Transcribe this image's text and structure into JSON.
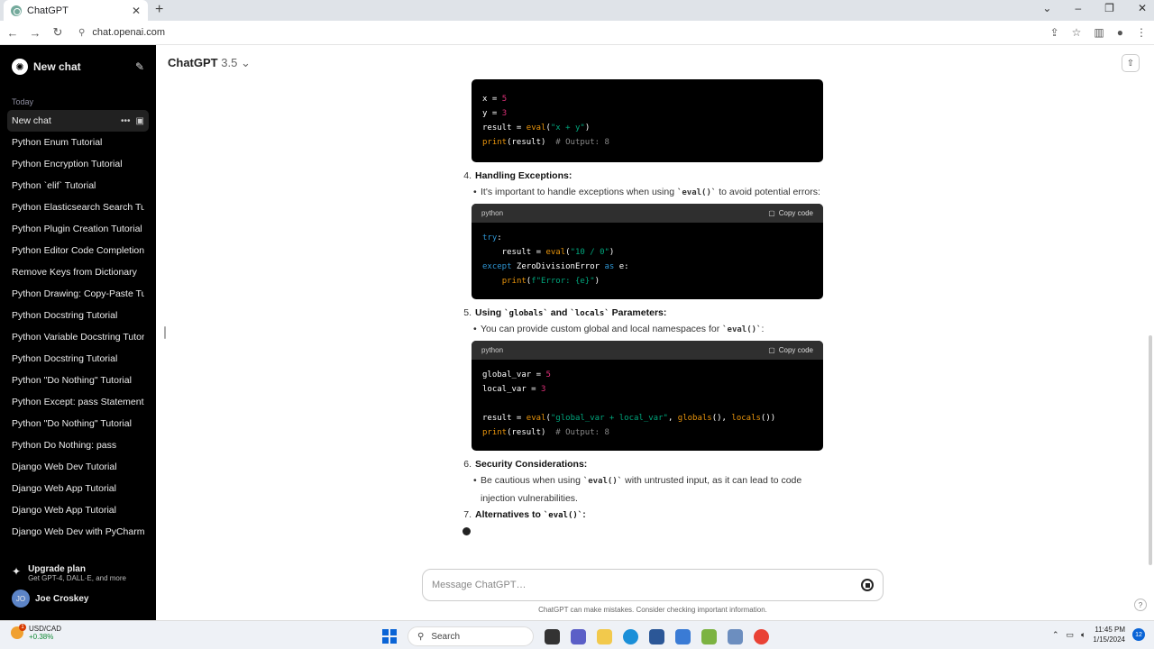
{
  "browser": {
    "tab_title": "ChatGPT",
    "url": "chat.openai.com"
  },
  "sidebar": {
    "new_chat": "New chat",
    "section": "Today",
    "active_item": "New chat",
    "items": [
      "Python Enum Tutorial",
      "Python Encryption Tutorial",
      "Python `elif` Tutorial",
      "Python Elasticsearch Search Tuto",
      "Python Plugin Creation Tutorial",
      "Python Editor Code Completion",
      "Remove Keys from Dictionary",
      "Python Drawing: Copy-Paste Tuto",
      "Python Docstring Tutorial",
      "Python Variable Docstring Tutoria",
      "Python Docstring Tutorial",
      "Python \"Do Nothing\" Tutorial",
      "Python Except: pass Statement",
      "Python \"Do Nothing\" Tutorial",
      "Python Do Nothing: pass",
      "Django Web Dev Tutorial",
      "Django Web App Tutorial",
      "Django Web App Tutorial",
      "Django Web Dev with PyCharm"
    ],
    "upgrade_title": "Upgrade plan",
    "upgrade_sub": "Get GPT-4, DALL·E, and more",
    "user_initials": "JO",
    "user_name": "Joe Croskey"
  },
  "header": {
    "model": "ChatGPT",
    "version": "3.5"
  },
  "content": {
    "step4_num": "4.",
    "step4_title": "Handling Exceptions:",
    "step4_text_a": "It's important to handle exceptions when using ",
    "step4_code": "`eval()`",
    "step4_text_b": " to avoid potential errors:",
    "step5_num": "5.",
    "step5_a": "Using ",
    "step5_code1": "`globals`",
    "step5_b": " and ",
    "step5_code2": "`locals`",
    "step5_c": " Parameters:",
    "step5_text_a": "You can provide custom global and local namespaces for ",
    "step5_code": "`eval()`",
    "step5_text_b": ":",
    "step6_num": "6.",
    "step6_title": "Security Considerations:",
    "step6_text_a": "Be cautious when using ",
    "step6_code": "`eval()`",
    "step6_text_b": " with untrusted input, as it can lead to code",
    "step6_text_c": "injection vulnerabilities.",
    "step7_num": "7.",
    "step7_title": "Alternatives to ",
    "step7_code": "`eval()`",
    "step7_colon": ":",
    "code_lang": "python",
    "copy_label": "Copy code"
  },
  "composer": {
    "placeholder": "Message ChatGPT…",
    "disclaimer": "ChatGPT can make mistakes. Consider checking important information."
  },
  "taskbar": {
    "ticker": "USD/CAD",
    "change": "+0.38%",
    "search": "Search",
    "time": "11:45 PM",
    "date": "1/15/2024",
    "notif_count": "12",
    "weather_badge": "1"
  }
}
